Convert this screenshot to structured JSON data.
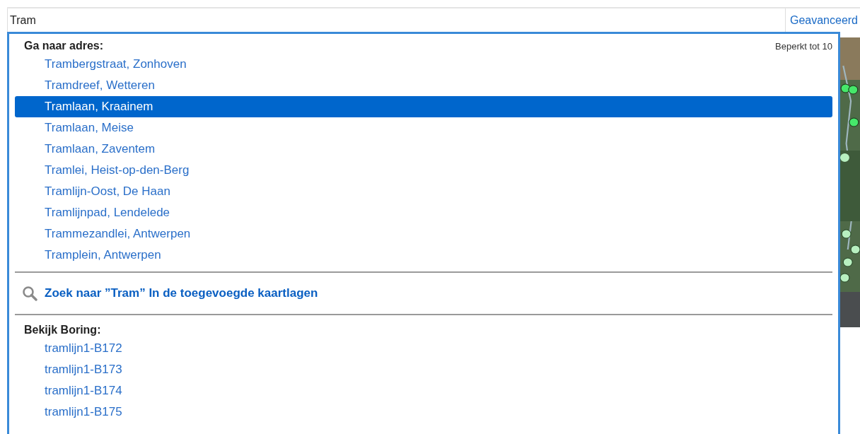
{
  "search": {
    "value": "Tram",
    "advanced_button": "Geavanceerd"
  },
  "dropdown": {
    "address_heading": "Ga naar adres:",
    "limit_note": "Beperkt tot 10",
    "addresses": [
      {
        "label": "Trambergstraat, Zonhoven",
        "selected": false
      },
      {
        "label": "Tramdreef, Wetteren",
        "selected": false
      },
      {
        "label": "Tramlaan, Kraainem",
        "selected": true
      },
      {
        "label": "Tramlaan, Meise",
        "selected": false
      },
      {
        "label": "Tramlaan, Zaventem",
        "selected": false
      },
      {
        "label": "Tramlei, Heist-op-den-Berg",
        "selected": false
      },
      {
        "label": "Tramlijn-Oost, De Haan",
        "selected": false
      },
      {
        "label": "Tramlijnpad, Lendelede",
        "selected": false
      },
      {
        "label": "Trammezandlei, Antwerpen",
        "selected": false
      },
      {
        "label": "Tramplein, Antwerpen",
        "selected": false
      }
    ],
    "layer_search": "Zoek naar ”Tram” In de toegevoegde kaartlagen",
    "boring_heading": "Bekijk Boring:",
    "borings": [
      "tramlijn1-B172",
      "tramlijn1-B173",
      "tramlijn1-B174",
      "tramlijn1-B175"
    ]
  }
}
